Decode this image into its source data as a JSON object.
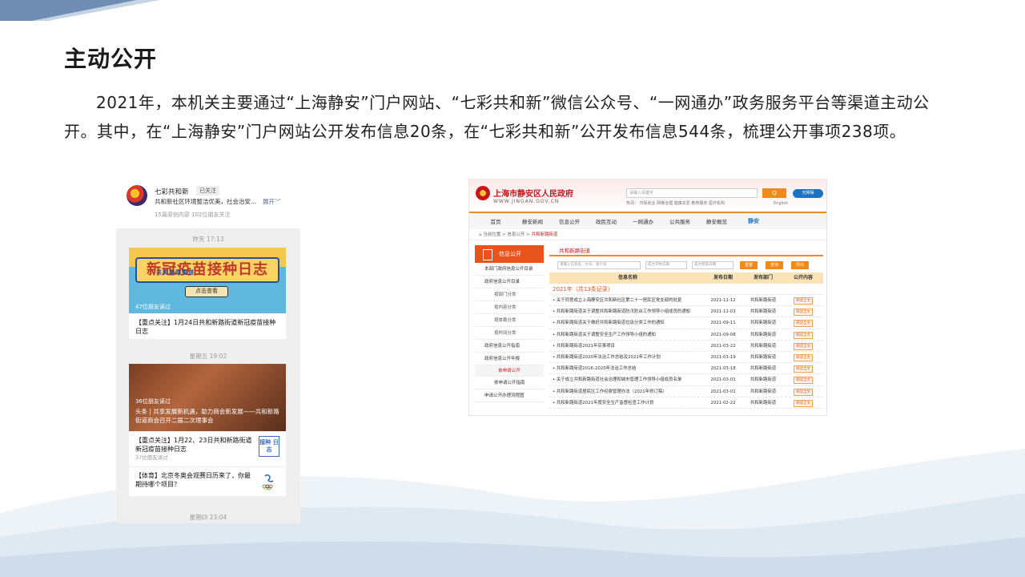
{
  "slide": {
    "title": "主动公开",
    "paragraph": "2021年，本机关主要通过“上海静安”门户网站、“七彩共和新”微信公众号、“一网通办”政务服务平台等渠道主动公开。其中，在“上海静安”门户网站公开发布信息20条，在“七彩共和新”公开发布信息544条，梳理公开事项238项。"
  },
  "wechat": {
    "account_name": "七彩共和新",
    "follow_status": "已关注",
    "description": "共和新社区环境整洁优美，社会治安...",
    "expand": "展开",
    "stats": "15篇原创内容  102位朋友关注",
    "time1": "昨天  17:13",
    "card1_sub": "共和新路街道",
    "card1_banner": "新冠疫苗接种日志",
    "card1_button": "点击查看",
    "card1_reads": "47位朋友读过",
    "card1_title": "【重点关注】1月24日共和新路街道新冠疫苗接种日志",
    "time2": "星期五  19:02",
    "card2_reads": "36位朋友读过",
    "card2_caption": "头条 | 共享发展新机遇，助力商会新发展——共和新路街道商会召开二届二次理事会",
    "row1_title": "【重点关注】1月22、23日共和新路街道新冠疫苗接种日志",
    "row1_reads": "37位朋友读过",
    "row1_thumb": "接种 日志",
    "row2_title": "【体育】北京冬奥会观赛日历来了，你最期待哪个项目？",
    "time3": "星期四  23:04"
  },
  "gov": {
    "logo": "上海市静安区人民政府",
    "url": "WWW.JINGAN.GOV.CN",
    "search_placeholder": "请输入关键字",
    "search_button": "Q",
    "badge": "无障碍",
    "hot": "热词：  市民就业    网格治理    健康关爱    教育服务    医疗机构",
    "lang": "English",
    "nav": [
      "首页",
      "静安新闻",
      "信息公开",
      "政民互动",
      "一网通办",
      "公共服务",
      "静安概览",
      "静安"
    ],
    "breadcrumb_prefix": "当前位置 > 信息公开 > ",
    "breadcrumb_current": "共和新路街道",
    "side_head": "信息公开",
    "side_items": [
      {
        "label": "本部门政府信息公开目录",
        "sub": false
      },
      {
        "label": "政府信息公开目录",
        "sub": false
      },
      {
        "label": "按部门分类",
        "sub": true
      },
      {
        "label": "按内容分类",
        "sub": true
      },
      {
        "label": "按体裁分类",
        "sub": true
      },
      {
        "label": "按时间分类",
        "sub": true
      },
      {
        "label": "政府信息公开指南",
        "sub": false
      },
      {
        "label": "政府信息公开年报",
        "sub": false
      }
    ],
    "side_group": "依申请公开",
    "side_items2": [
      "依申请公开指南",
      "申请公开办理流程图"
    ],
    "main_head": "共和新路街道",
    "filter_keyword": "请输入信息名、文号、索引号",
    "filter_start": "成文开始日期",
    "filter_end": "成文结束日期",
    "btn_reset": "重置",
    "btn_search": "查询",
    "btn_export": "导出",
    "col_name": "信息名称",
    "col_date": "发布日期",
    "col_dept": "发布部门",
    "col_act": "公开内容",
    "year_label": "2021年（共13条记录）",
    "rows": [
      {
        "name": "关于同意成立上海静安区共和新社区第二十一居民区党支部的批复",
        "date": "2021-11-12",
        "dept": "共和新路街道",
        "act": "阅读全文"
      },
      {
        "name": "共和新路街道关于调整共和新路街道防汛防台工作领导小组成员的通知",
        "date": "2021-11-03",
        "dept": "共和新路街道",
        "act": "阅读全文"
      },
      {
        "name": "共和新路街道关于做好共和新路街道垃圾分类工作的通知",
        "date": "2021-09-11",
        "dept": "共和新路街道",
        "act": "阅读全文"
      },
      {
        "name": "共和新路街道关于调整安全生产工作领导小组的通知",
        "date": "2021-09-08",
        "dept": "共和新路街道",
        "act": "阅读全文"
      },
      {
        "name": "共和新路街道2021年实事项目",
        "date": "2021-03-22",
        "dept": "共和新路街道",
        "act": "阅读全文"
      },
      {
        "name": "共和新路街道2020年法治工作总结及2021年工作计划",
        "date": "2021-03-19",
        "dept": "共和新路街道",
        "act": "阅读全文"
      },
      {
        "name": "共和新路街道2016-2020年法治工作总结",
        "date": "2021-03-18",
        "dept": "共和新路街道",
        "act": "阅读全文"
      },
      {
        "name": "关于成立共和新路街道社会治理和城市管理工作领导小组成员名单",
        "date": "2021-03-01",
        "dept": "共和新路街道",
        "act": "阅读全文"
      },
      {
        "name": "共和新路街道居民区工作经费管理办法（2021年修订稿）",
        "date": "2021-03-01",
        "dept": "共和新路街道",
        "act": "阅读全文"
      },
      {
        "name": "共和新路街道2021年度安全生产监督检查工作计划",
        "date": "2021-02-22",
        "dept": "共和新路街道",
        "act": "阅读全文"
      }
    ]
  },
  "colors": {
    "accent_orange": "#f08a1c",
    "gov_red": "#c8161d",
    "band_blue": "#3a5a8c"
  }
}
